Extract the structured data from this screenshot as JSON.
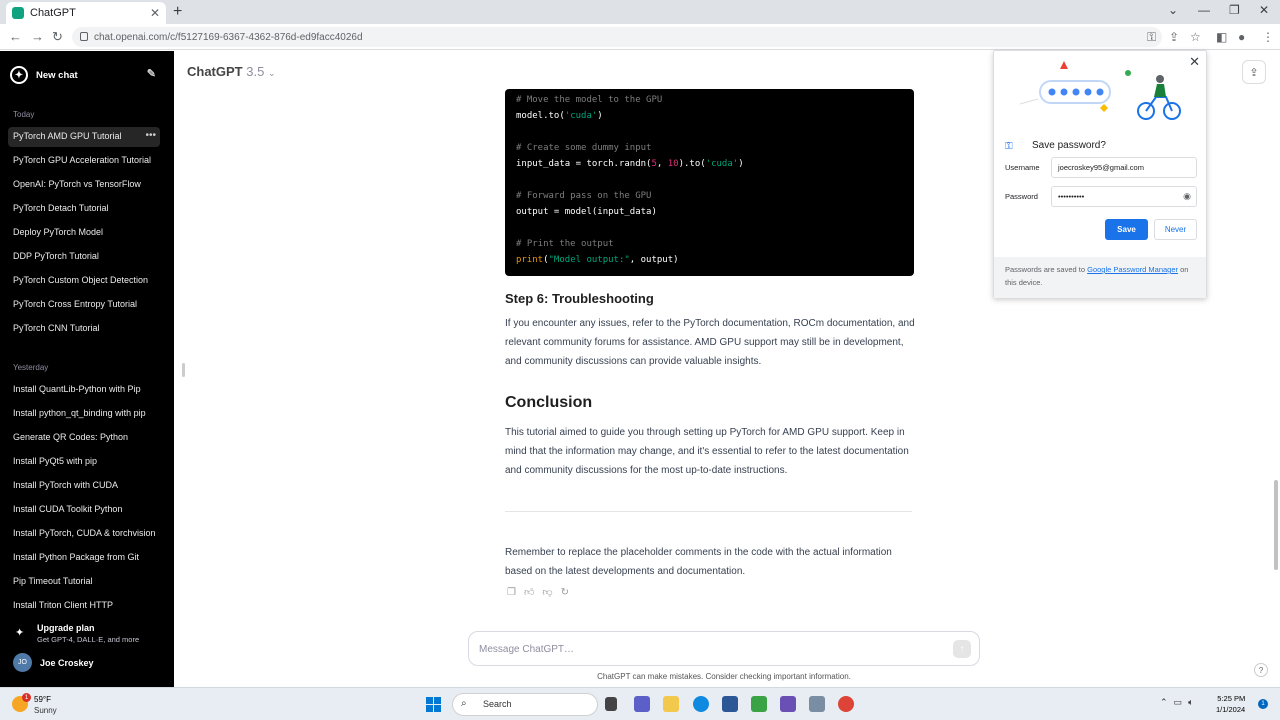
{
  "browser": {
    "tab_title": "ChatGPT",
    "tab_close": "✕",
    "new_tab": "+",
    "url": "chat.openai.com/c/f5127169-6367-4362-876d-ed9facc4026d"
  },
  "sidebar": {
    "new_chat": "New chat",
    "today_label": "Today",
    "today_items": [
      "PyTorch AMD GPU Tutorial",
      "PyTorch GPU Acceleration Tutorial",
      "OpenAI: PyTorch vs TensorFlow",
      "PyTorch Detach Tutorial",
      "Deploy PyTorch Model",
      "DDP PyTorch Tutorial",
      "PyTorch Custom Object Detection",
      "PyTorch Cross Entropy Tutorial",
      "PyTorch CNN Tutorial"
    ],
    "yesterday_label": "Yesterday",
    "yesterday_items": [
      "Install QuantLib-Python with Pip",
      "Install python_qt_binding with pip",
      "Generate QR Codes: Python",
      "Install PyQt5 with pip",
      "Install PyTorch with CUDA",
      "Install CUDA Toolkit Python",
      "Install PyTorch, CUDA & torchvision",
      "Install Python Package from Git",
      "Pip Timeout Tutorial",
      "Install Triton Client HTTP"
    ],
    "upgrade_title": "Upgrade plan",
    "upgrade_sub": "Get GPT-4, DALL·E, and more",
    "user_initials": "JO",
    "user_name": "Joe Croskey"
  },
  "main": {
    "model_name": "ChatGPT",
    "model_version": "3.5",
    "code_lines": [
      [
        {
          "t": "# Move the model to the GPU",
          "c": "cm"
        }
      ],
      [
        {
          "t": "model.to(",
          "c": ""
        },
        {
          "t": "'cuda'",
          "c": "st"
        },
        {
          "t": ")",
          "c": ""
        }
      ],
      [],
      [
        {
          "t": "# Create some dummy input",
          "c": "cm"
        }
      ],
      [
        {
          "t": "input_data = torch.randn(",
          "c": ""
        },
        {
          "t": "5",
          "c": "nm"
        },
        {
          "t": ", ",
          "c": ""
        },
        {
          "t": "10",
          "c": "nm"
        },
        {
          "t": ").to(",
          "c": ""
        },
        {
          "t": "'cuda'",
          "c": "st"
        },
        {
          "t": ")",
          "c": ""
        }
      ],
      [],
      [
        {
          "t": "# Forward pass on the GPU",
          "c": "cm"
        }
      ],
      [
        {
          "t": "output = model(input_data)",
          "c": ""
        }
      ],
      [],
      [
        {
          "t": "# Print the output",
          "c": "cm"
        }
      ],
      [
        {
          "t": "print",
          "c": "fn"
        },
        {
          "t": "(",
          "c": ""
        },
        {
          "t": "\"Model output:\"",
          "c": "st"
        },
        {
          "t": ", output)",
          "c": ""
        }
      ]
    ],
    "step6_heading": "Step 6: Troubleshooting",
    "step6_text": "If you encounter any issues, refer to the PyTorch documentation, ROCm documentation, and relevant community forums for assistance. AMD GPU support may still be in development, and community discussions can provide valuable insights.",
    "conclusion_heading": "Conclusion",
    "conclusion_text": "This tutorial aimed to guide you through setting up PyTorch for AMD GPU support. Keep in mind that the information may change, and it's essential to refer to the latest documentation and community discussions for the most up-to-date instructions.",
    "final_text": "Remember to replace the placeholder comments in the code with the actual information based on the latest developments and documentation.",
    "composer_placeholder": "Message ChatGPT…",
    "disclaimer": "ChatGPT can make mistakes. Consider checking important information.",
    "help": "?"
  },
  "password_popup": {
    "title": "Save password?",
    "username_label": "Username",
    "username_value": "joecroskey95@gmail.com",
    "password_label": "Password",
    "password_value": "••••••••••",
    "save_label": "Save",
    "never_label": "Never",
    "footer_prefix": "Passwords are saved to ",
    "footer_link": "Google Password Manager",
    "footer_suffix": " on this device."
  },
  "taskbar": {
    "weather_badge": "1",
    "temp": "59°F",
    "condition": "Sunny",
    "search_label": "Search",
    "time": "5:25 PM",
    "date": "1/1/2024",
    "notification_count": "1"
  },
  "colors": {
    "accent": "#1a73e8",
    "sidebar_bg": "#000000",
    "code_string": "#00a67d",
    "code_number": "#df3079"
  }
}
